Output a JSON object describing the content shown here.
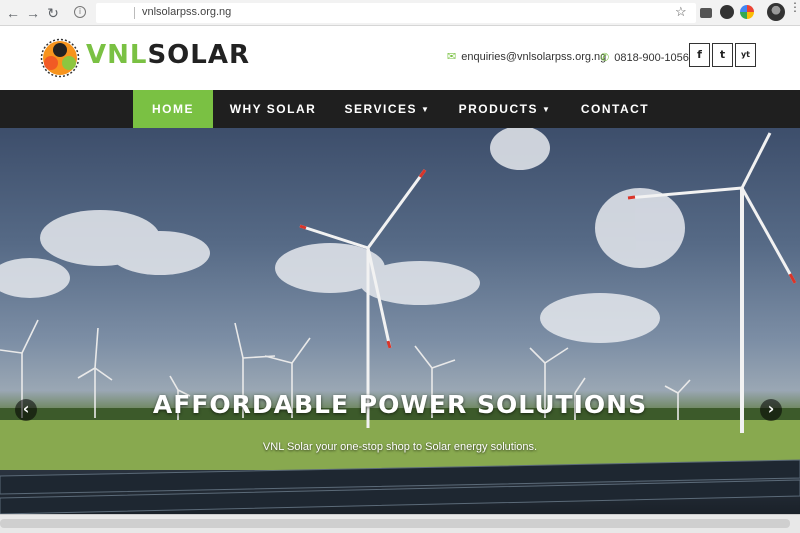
{
  "browser": {
    "url": "vnlsolarpss.org.ng",
    "back_icon": "arrow-left-icon",
    "forward_icon": "arrow-right-icon",
    "reload_icon": "reload-icon"
  },
  "header": {
    "brand_primary": "VNL",
    "brand_secondary": "SOLAR",
    "email": "enquiries@vnlsolarpss.org.ng",
    "phone": "0818-900-1056",
    "social": [
      "f",
      "t",
      "yt"
    ]
  },
  "nav": {
    "items": [
      {
        "label": "HOME",
        "active": true
      },
      {
        "label": "WHY SOLAR",
        "active": false
      },
      {
        "label": "SERVICES",
        "active": false,
        "dropdown": true
      },
      {
        "label": "PRODUCTS",
        "active": false,
        "dropdown": true
      },
      {
        "label": "CONTACT",
        "active": false
      }
    ]
  },
  "hero": {
    "title": "AFFORDABLE POWER SOLUTIONS",
    "subtitle": "VNL Solar your one-stop shop to Solar energy solutions.",
    "prev_icon": "chevron-left-icon",
    "next_icon": "chevron-right-icon"
  },
  "colors": {
    "accent": "#7ac143",
    "nav_bg": "#1f1f1f"
  }
}
